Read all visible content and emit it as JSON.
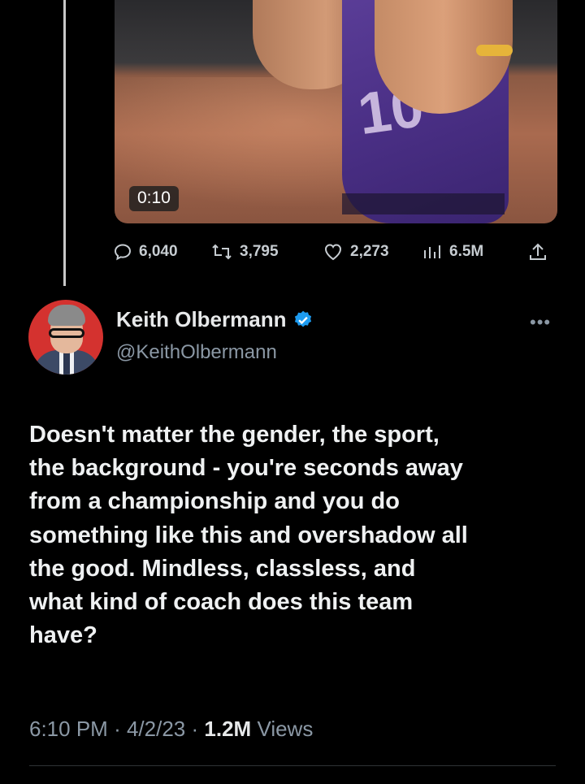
{
  "video": {
    "duration": "0:10"
  },
  "actions": {
    "replies": "6,040",
    "retweets": "3,795",
    "likes": "2,273",
    "views": "6.5M"
  },
  "author": {
    "display_name": "Keith Olbermann",
    "handle": "@KeithOlbermann",
    "verified": true
  },
  "tweet": {
    "lines": [
      "Doesn't matter the gender, the sport,",
      "the background - you're seconds away",
      "from a championship and you do",
      "something like this and overshadow all",
      "the good. Mindless, classless, and",
      "what kind of coach does this team",
      "have?"
    ]
  },
  "meta": {
    "time": "6:10 PM",
    "separator": "·",
    "date": "4/2/23",
    "views_count": "1.2M",
    "views_label": "Views"
  },
  "colors": {
    "background": "#000000",
    "text": "#e7e9ea",
    "secondary": "#8b98a5",
    "verified": "#1d9bf0"
  }
}
